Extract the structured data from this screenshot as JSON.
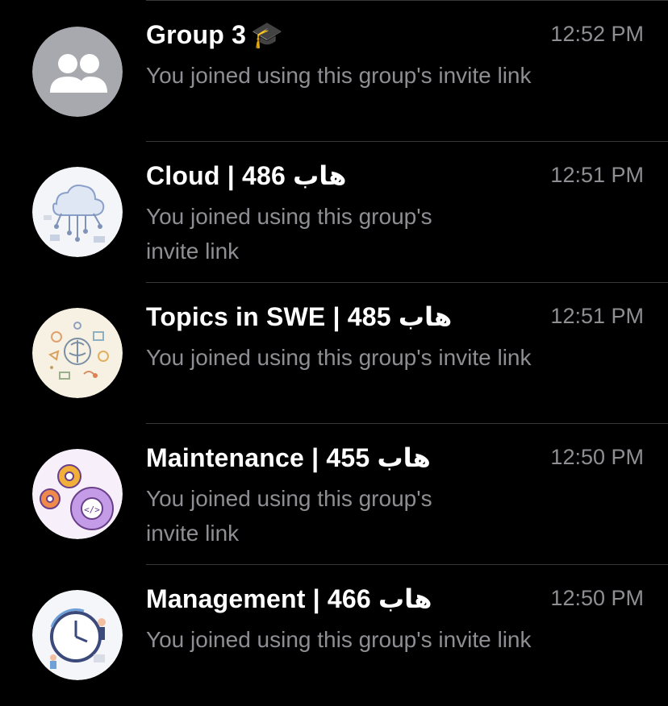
{
  "colors": {
    "background": "#000000",
    "title": "#ffffff",
    "secondary_text": "#8e8e93",
    "separator": "#38383a",
    "default_avatar_bg": "#a8a9ae"
  },
  "chats": [
    {
      "title": "Group 3",
      "emoji": "🎓",
      "time": "12:52 PM",
      "preview": "You joined using this group's invite link",
      "avatar": "group-placeholder-icon"
    },
    {
      "title": "Cloud | 486 هاب",
      "time": "12:51 PM",
      "preview": "You joined using this group's invite link",
      "avatar": "cloud-circuit-icon"
    },
    {
      "title": "Topics in SWE | 485 هاب",
      "time": "12:51 PM",
      "preview": "You joined using this group's invite link",
      "avatar": "tech-doodle-brain-icon"
    },
    {
      "title": "Maintenance | 455 هاب",
      "time": "12:50 PM",
      "preview": "You joined using this group's invite link",
      "avatar": "gears-code-icon"
    },
    {
      "title": "Management | 466 هاب",
      "time": "12:50 PM",
      "preview": "You joined using this group's invite link",
      "avatar": "clock-team-icon"
    }
  ]
}
